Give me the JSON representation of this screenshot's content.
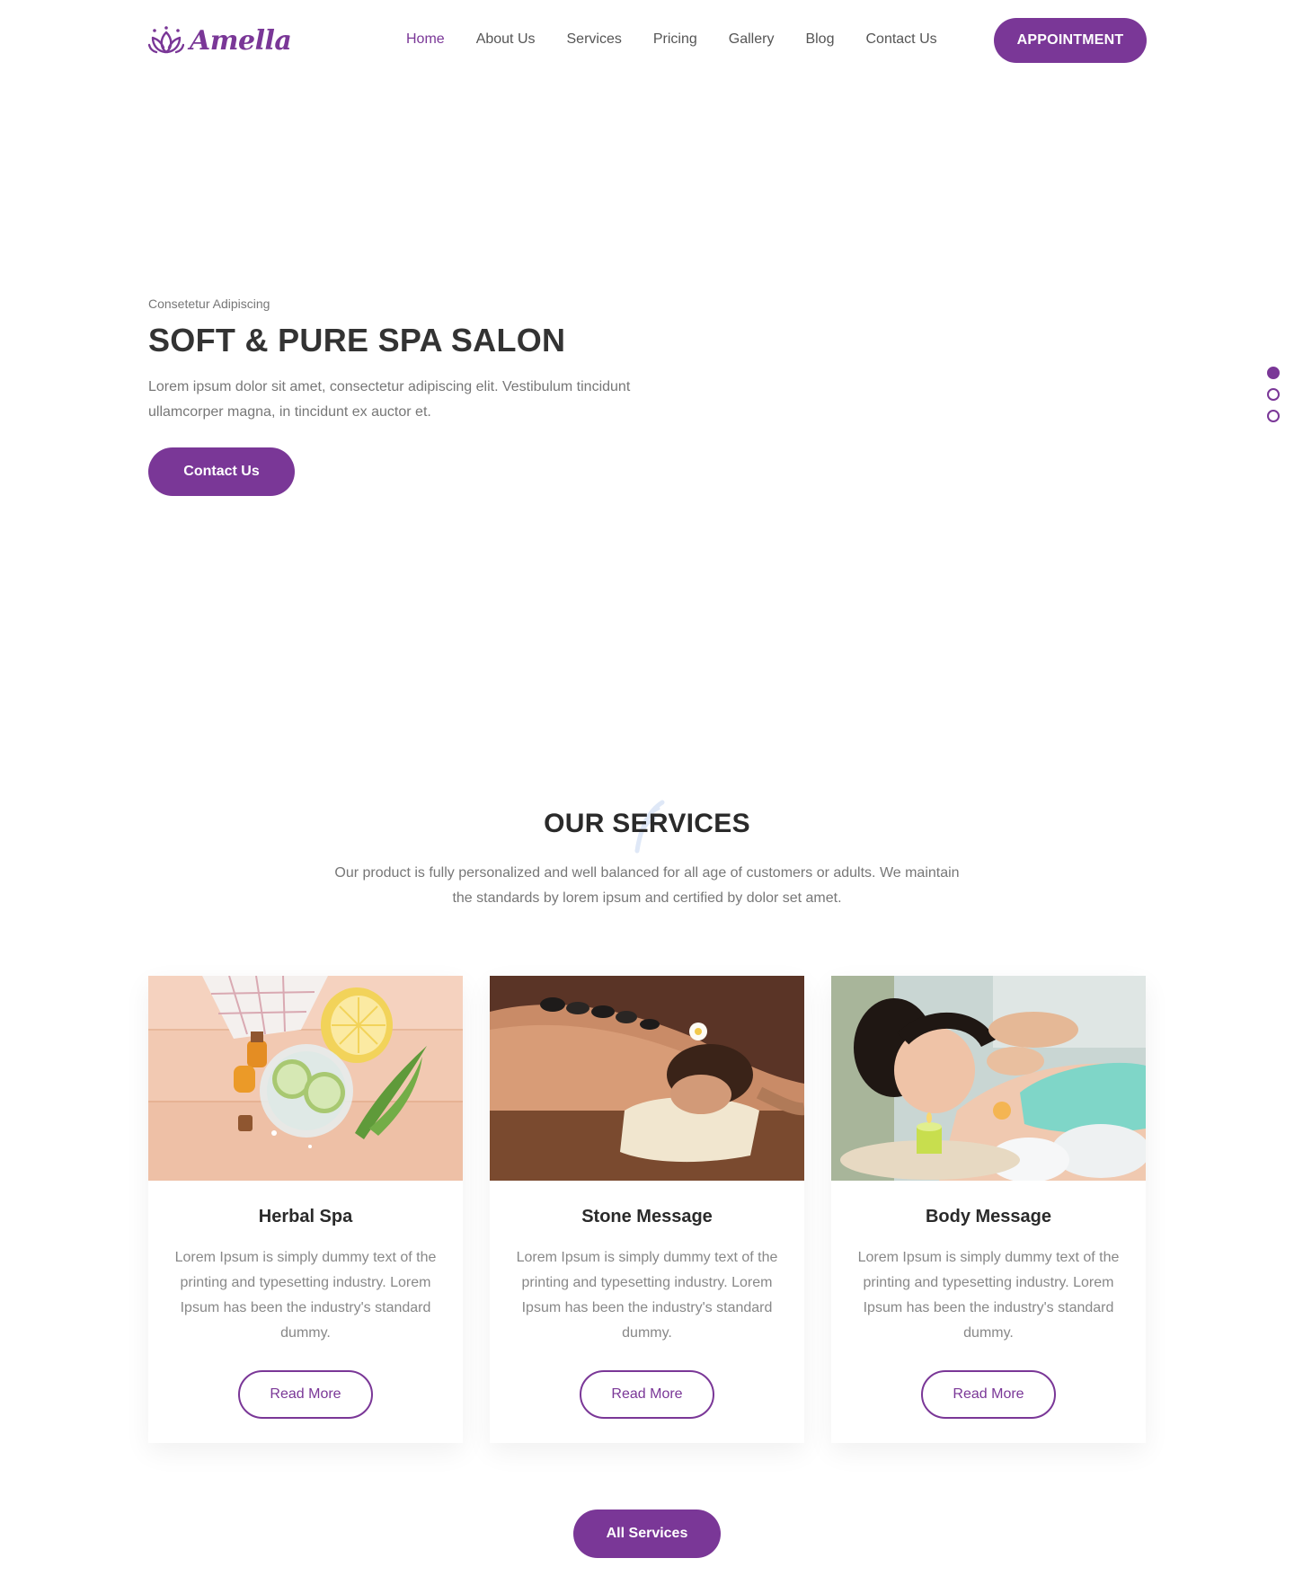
{
  "brand": {
    "name": "Amella",
    "accent_color": "#7a3797",
    "logo_icon": "lotus-icon"
  },
  "nav": {
    "items": [
      {
        "label": "Home",
        "active": true
      },
      {
        "label": "About Us",
        "active": false
      },
      {
        "label": "Services",
        "active": false
      },
      {
        "label": "Pricing",
        "active": false
      },
      {
        "label": "Gallery",
        "active": false
      },
      {
        "label": "Blog",
        "active": false
      },
      {
        "label": "Contact Us",
        "active": false
      }
    ],
    "cta_label": "APPOINTMENT"
  },
  "hero": {
    "kicker": "Consetetur Adipiscing",
    "title": "SOFT & PURE SPA SALON",
    "text": "Lorem ipsum dolor sit amet, consectetur adipiscing elit. Vestibulum tincidunt ullamcorper magna, in tincidunt ex auctor et.",
    "button_label": "Contact Us",
    "slides": {
      "count": 3,
      "active_index": 0
    }
  },
  "services": {
    "title": "OUR SERVICES",
    "intro": "Our product is fully personalized and well balanced for all age of customers or adults. We maintain the standards by lorem ipsum and certified by dolor set amet.",
    "cards": [
      {
        "title": "Herbal Spa",
        "image": "herbal-spa-image",
        "text": "Lorem Ipsum is simply dummy text of the printing and typesetting industry. Lorem Ipsum has been the industry's standard dummy.",
        "button_label": "Read More"
      },
      {
        "title": "Stone Message",
        "image": "stone-massage-image",
        "text": "Lorem Ipsum is simply dummy text of the printing and typesetting industry. Lorem Ipsum has been the industry's standard dummy.",
        "button_label": "Read More"
      },
      {
        "title": "Body Message",
        "image": "body-massage-image",
        "text": "Lorem Ipsum is simply dummy text of the printing and typesetting industry. Lorem Ipsum has been the industry's standard dummy.",
        "button_label": "Read More"
      }
    ],
    "all_button_label": "All Services"
  }
}
